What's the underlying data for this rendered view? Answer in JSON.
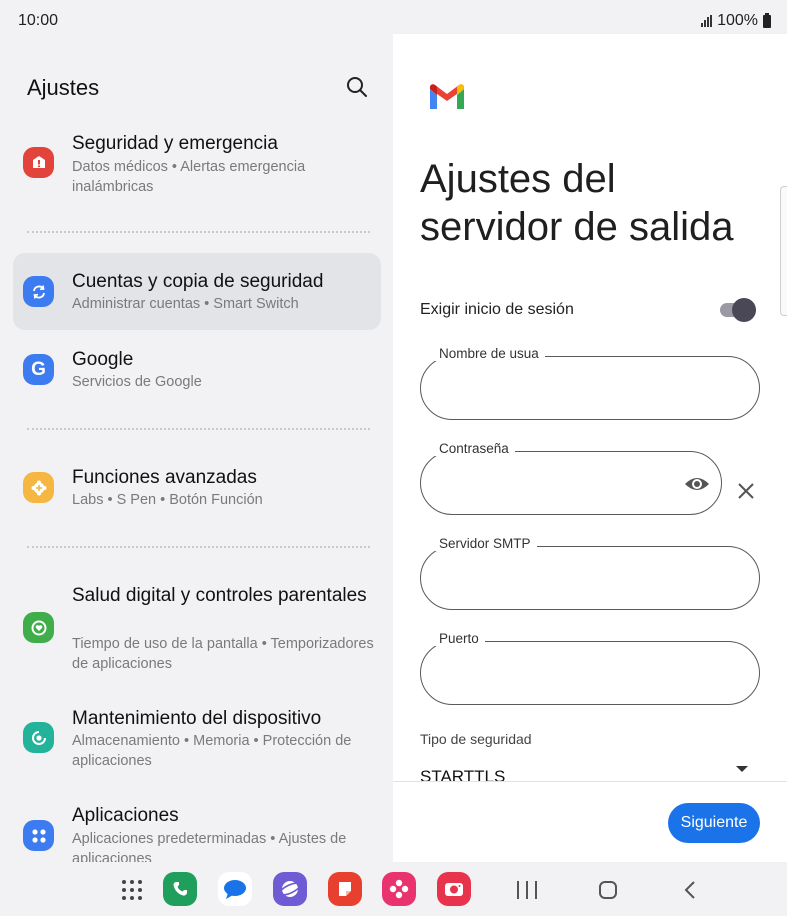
{
  "status_bar": {
    "time": "10:00",
    "battery": "100%"
  },
  "settings": {
    "title": "Ajustes",
    "items": [
      {
        "title": "Seguridad y emergencia",
        "subtitle": "Datos médicos  •  Alertas emergencia inalámbricas",
        "icon": "shield-alert-icon",
        "color": "#e2433b"
      },
      {
        "title": "Cuentas y copia de seguridad",
        "subtitle": "Administrar cuentas  •  Smart Switch",
        "icon": "sync-icon",
        "color": "#3d7cf0"
      },
      {
        "title": "Google",
        "subtitle": "Servicios de Google",
        "icon": "google-icon",
        "color": "#3d7cf0"
      },
      {
        "title": "Funciones avanzadas",
        "subtitle": "Labs  •  S Pen  •  Botón Función",
        "icon": "gear-plus-icon",
        "color": "#f5b742"
      },
      {
        "title": "Salud digital y controles parentales",
        "subtitle": "Tiempo de uso de la pantalla  •  Temporizadores de aplicaciones",
        "icon": "digital-wellbeing-icon",
        "color": "#3fae4a"
      },
      {
        "title": "Mantenimiento del dispositivo",
        "subtitle": "Almacenamiento  •  Memoria  •  Protección de aplicaciones",
        "icon": "device-care-icon",
        "color": "#23b39b"
      },
      {
        "title": "Aplicaciones",
        "subtitle": "Aplicaciones predeterminadas  •  Ajustes de aplicaciones",
        "icon": "apps-icon",
        "color": "#3d7cf0"
      }
    ]
  },
  "gmail": {
    "title": "Ajustes del servidor de salida",
    "require_login_label": "Exigir inicio de sesión",
    "require_login": true,
    "fields": {
      "username": {
        "label": "Nombre de usua",
        "value": ""
      },
      "password": {
        "label": "Contraseña",
        "value": ""
      },
      "smtp_server": {
        "label": "Servidor SMTP",
        "value": ""
      },
      "port": {
        "label": "Puerto",
        "value": ""
      }
    },
    "security_label": "Tipo de seguridad",
    "security_value": "STARTTLS",
    "next_label": "Siguiente",
    "colors": {
      "accent": "#1a73e8"
    }
  },
  "dock": [
    {
      "name": "phone-app",
      "color": "#1f9e5c"
    },
    {
      "name": "messages-app",
      "color": "#ffffff"
    },
    {
      "name": "internet-app",
      "color": "#6f5bd3"
    },
    {
      "name": "notes-app",
      "color": "#e8402e"
    },
    {
      "name": "gallery-app",
      "color": "#e8336f"
    },
    {
      "name": "camera-app",
      "color": "#e8334d"
    }
  ]
}
